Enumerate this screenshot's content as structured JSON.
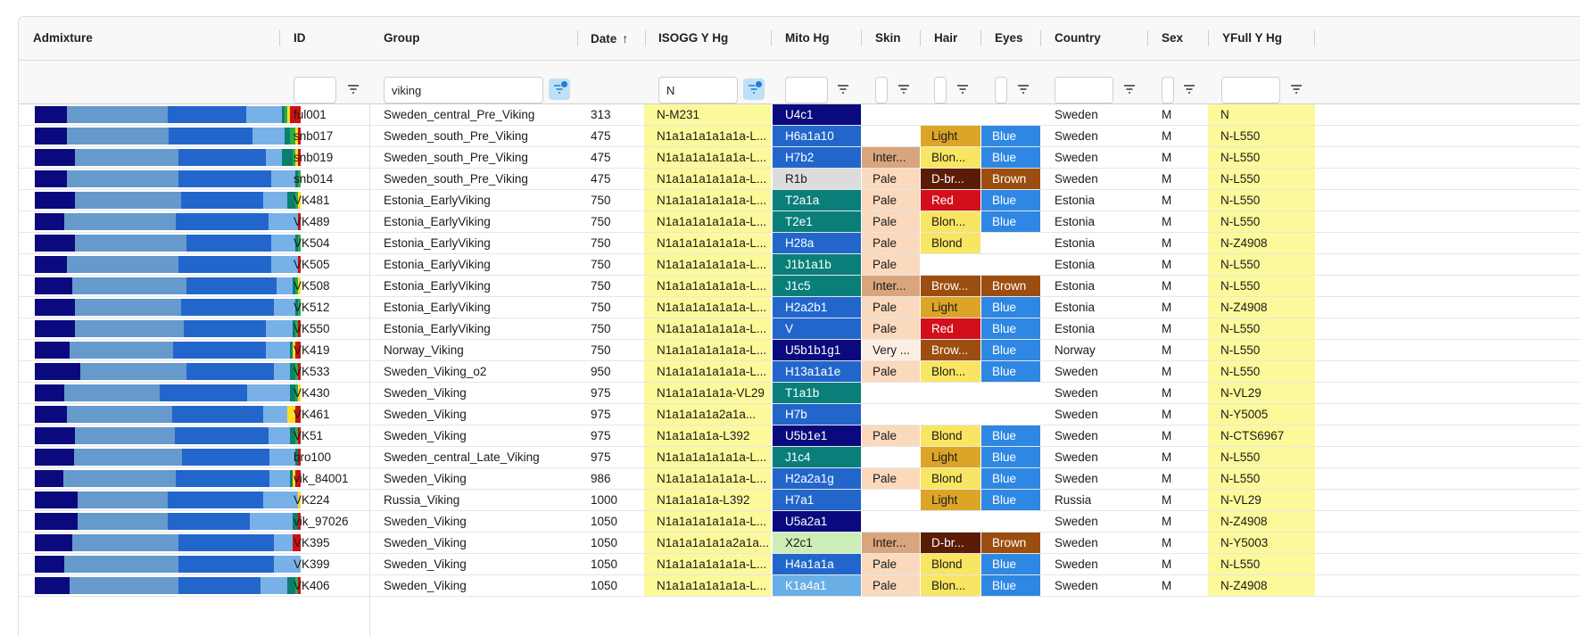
{
  "columns": {
    "admixture": "Admixture",
    "id": "ID",
    "group": "Group",
    "date": "Date",
    "isogg": "ISOGG Y Hg",
    "mito": "Mito Hg",
    "skin": "Skin",
    "hair": "Hair",
    "eyes": "Eyes",
    "country": "Country",
    "sex": "Sex",
    "yfull": "YFull Y Hg"
  },
  "sort": {
    "column": "date",
    "direction": "ascending",
    "icon": "arrow-up-icon"
  },
  "filters": {
    "id": "",
    "group": "viking",
    "isogg": "N",
    "mito": "",
    "skin": "",
    "hair": "",
    "eyes": "",
    "country": "",
    "sex": "",
    "yfull": ""
  },
  "active_filters": [
    "group",
    "isogg"
  ],
  "colors": {
    "isogg_bg": "#fcf99a",
    "yfull_bg": "#fcf99a",
    "filter_active_bg": "#bfe0f7",
    "filter_active_dot": "#1f7fd6",
    "mito": {
      "U": "#0a0a7e",
      "H": "#2266cc",
      "R": "#dcdcdc",
      "T": "#0a7f7a",
      "J": "#0a7f7a",
      "V": "#2266cc",
      "X": "#cdeeb7",
      "K": "#6aaee6"
    },
    "skin": {
      "Pale": "#fbd9bd",
      "Inter...": "#d9a57d",
      "Very ...": "#fdeee4"
    },
    "hair": {
      "Light": "#dca527",
      "Blon...": "#f8e662",
      "Blond": "#f8e662",
      "D-br...": "#5a1c04",
      "Red": "#d40f1c",
      "Brow...": "#9c4d10"
    },
    "eyes": {
      "Blue": "#2e87e2",
      "Brown": "#9c4d10"
    }
  },
  "rows": [
    {
      "id": "ful001",
      "group": "Sweden_central_Pre_Viking",
      "date": "313",
      "isogg": "N-M231",
      "mito": "U4c1",
      "skin": "",
      "hair": "",
      "eyes": "",
      "country": "Sweden",
      "sex": "M",
      "yfull": "N",
      "admixture": [
        12,
        37,
        29,
        13,
        1,
        1,
        1,
        4
      ]
    },
    {
      "id": "snb017",
      "group": "Sweden_south_Pre_Viking",
      "date": "475",
      "isogg": "N1a1a1a1a1a1a-L...",
      "mito": "H6a1a10",
      "skin": "",
      "hair": "Light",
      "eyes": "Blue",
      "country": "Sweden",
      "sex": "M",
      "yfull": "N-L550",
      "admixture": [
        12,
        38,
        31,
        12,
        2,
        2,
        1,
        1
      ]
    },
    {
      "id": "snb019",
      "group": "Sweden_south_Pre_Viking",
      "date": "475",
      "isogg": "N1a1a1a1a1a1a-L...",
      "mito": "H7b2",
      "skin": "Inter...",
      "hair": "Blon...",
      "eyes": "Blue",
      "country": "Sweden",
      "sex": "M",
      "yfull": "N-L550",
      "admixture": [
        15,
        39,
        33,
        6,
        4,
        1,
        1,
        1
      ]
    },
    {
      "id": "snb014",
      "group": "Sweden_south_Pre_Viking",
      "date": "475",
      "isogg": "N1a1a1a1a1a1a-L...",
      "mito": "R1b",
      "skin": "Pale",
      "hair": "D-br...",
      "eyes": "Brown",
      "country": "Sweden",
      "sex": "M",
      "yfull": "N-L550",
      "admixture": [
        12,
        42,
        35,
        9,
        1,
        1,
        0,
        0
      ]
    },
    {
      "id": "VK481",
      "group": "Estonia_EarlyViking",
      "date": "750",
      "isogg": "N1a1a1a1a1a1a-L...",
      "mito": "T2a1a",
      "skin": "Pale",
      "hair": "Red",
      "eyes": "Blue",
      "country": "Estonia",
      "sex": "M",
      "yfull": "N-L550",
      "admixture": [
        15,
        40,
        31,
        9,
        3,
        1,
        1,
        0
      ]
    },
    {
      "id": "VK489",
      "group": "Estonia_EarlyViking",
      "date": "750",
      "isogg": "N1a1a1a1a1a1a-L...",
      "mito": "T2e1",
      "skin": "Pale",
      "hair": "Blon...",
      "eyes": "Blue",
      "country": "Estonia",
      "sex": "M",
      "yfull": "N-L550",
      "admixture": [
        11,
        42,
        35,
        11,
        0,
        0,
        0,
        1
      ]
    },
    {
      "id": "VK504",
      "group": "Estonia_EarlyViking",
      "date": "750",
      "isogg": "N1a1a1a1a1a1a-L...",
      "mito": "H28a",
      "skin": "Pale",
      "hair": "Blond",
      "eyes": "",
      "country": "Estonia",
      "sex": "M",
      "yfull": "N-Z4908",
      "admixture": [
        15,
        42,
        32,
        9,
        1,
        1,
        0,
        0
      ]
    },
    {
      "id": "VK505",
      "group": "Estonia_EarlyViking",
      "date": "750",
      "isogg": "N1a1a1a1a1a1a-L...",
      "mito": "J1b1a1b",
      "skin": "Pale",
      "hair": "",
      "eyes": "",
      "country": "Estonia",
      "sex": "M",
      "yfull": "N-L550",
      "admixture": [
        12,
        42,
        35,
        10,
        0,
        0,
        0,
        1
      ]
    },
    {
      "id": "VK508",
      "group": "Estonia_EarlyViking",
      "date": "750",
      "isogg": "N1a1a1a1a1a1a-L...",
      "mito": "J1c5",
      "skin": "Inter...",
      "hair": "Brow...",
      "eyes": "Brown",
      "country": "Estonia",
      "sex": "M",
      "yfull": "N-L550",
      "admixture": [
        14,
        43,
        34,
        6,
        1,
        1,
        1,
        0
      ]
    },
    {
      "id": "VK512",
      "group": "Estonia_EarlyViking",
      "date": "750",
      "isogg": "N1a1a1a1a1a1a-L...",
      "mito": "H2a2b1",
      "skin": "Pale",
      "hair": "Light",
      "eyes": "Blue",
      "country": "Estonia",
      "sex": "M",
      "yfull": "N-Z4908",
      "admixture": [
        15,
        40,
        35,
        8,
        1,
        1,
        0,
        0
      ]
    },
    {
      "id": "VK550",
      "group": "Estonia_EarlyViking",
      "date": "750",
      "isogg": "N1a1a1a1a1a1a-L...",
      "mito": "V",
      "skin": "Pale",
      "hair": "Red",
      "eyes": "Blue",
      "country": "Estonia",
      "sex": "M",
      "yfull": "N-L550",
      "admixture": [
        15,
        41,
        31,
        10,
        1,
        1,
        0,
        1
      ]
    },
    {
      "id": "VK419",
      "group": "Norway_Viking",
      "date": "750",
      "isogg": "N1a1a1a1a1a1a-L...",
      "mito": "U5b1b1g1",
      "skin": "Very ...",
      "hair": "Brow...",
      "eyes": "Blue",
      "country": "Norway",
      "sex": "M",
      "yfull": "N-L550",
      "admixture": [
        13,
        39,
        35,
        9,
        1,
        0,
        1,
        2
      ]
    },
    {
      "id": "VK533",
      "group": "Sweden_Viking_o2",
      "date": "950",
      "isogg": "N1a1a1a1a1a1a-L...",
      "mito": "H13a1a1e",
      "skin": "Pale",
      "hair": "Blon...",
      "eyes": "Blue",
      "country": "Sweden",
      "sex": "M",
      "yfull": "N-L550",
      "admixture": [
        17,
        40,
        33,
        6,
        2,
        1,
        0,
        1
      ]
    },
    {
      "id": "VK430",
      "group": "Sweden_Viking",
      "date": "975",
      "isogg": "N1a1a1a1a1a-VL29",
      "mito": "T1a1b",
      "skin": "",
      "hair": "",
      "eyes": "",
      "country": "Sweden",
      "sex": "M",
      "yfull": "N-VL29",
      "admixture": [
        11,
        36,
        33,
        16,
        2,
        1,
        1,
        0
      ]
    },
    {
      "id": "VK461",
      "group": "Sweden_Viking",
      "date": "975",
      "isogg": "N1a1a1a1a2a1a...",
      "mito": "H7b",
      "skin": "",
      "hair": "",
      "eyes": "",
      "country": "Sweden",
      "sex": "M",
      "yfull": "N-Y5005",
      "admixture": [
        12,
        39,
        34,
        9,
        0,
        0,
        3,
        2
      ]
    },
    {
      "id": "VK51",
      "group": "Sweden_Viking",
      "date": "975",
      "isogg": "N1a1a1a1a-L392",
      "mito": "U5b1e1",
      "skin": "Pale",
      "hair": "Blond",
      "eyes": "Blue",
      "country": "Sweden",
      "sex": "M",
      "yfull": "N-CTS6967",
      "admixture": [
        15,
        37,
        35,
        8,
        2,
        1,
        0,
        1
      ]
    },
    {
      "id": "bro100",
      "group": "Sweden_central_Late_Viking",
      "date": "975",
      "isogg": "N1a1a1a1a1a1a-L...",
      "mito": "J1c4",
      "skin": "",
      "hair": "Light",
      "eyes": "Blue",
      "country": "Sweden",
      "sex": "M",
      "yfull": "N-L550",
      "admixture": [
        15,
        41,
        33,
        10,
        1,
        0,
        0,
        1
      ]
    },
    {
      "id": "vik_84001",
      "group": "Sweden_Viking",
      "date": "986",
      "isogg": "N1a1a1a1a1a1a-L...",
      "mito": "H2a2a1g",
      "skin": "Pale",
      "hair": "Blond",
      "eyes": "Blue",
      "country": "Sweden",
      "sex": "M",
      "yfull": "N-L550",
      "admixture": [
        11,
        43,
        36,
        8,
        1,
        0,
        1,
        2
      ]
    },
    {
      "id": "VK224",
      "group": "Russia_Viking",
      "date": "1000",
      "isogg": "N1a1a1a1a-L392",
      "mito": "H7a1",
      "skin": "",
      "hair": "Light",
      "eyes": "Blue",
      "country": "Russia",
      "sex": "M",
      "yfull": "N-VL29",
      "admixture": [
        16,
        34,
        36,
        13,
        0,
        0,
        1,
        0
      ]
    },
    {
      "id": "vik_97026",
      "group": "Sweden_Viking",
      "date": "1050",
      "isogg": "N1a1a1a1a1a1a-L...",
      "mito": "U5a2a1",
      "skin": "",
      "hair": "",
      "eyes": "",
      "country": "Sweden",
      "sex": "M",
      "yfull": "N-Z4908",
      "admixture": [
        16,
        34,
        31,
        16,
        2,
        0,
        0,
        1
      ]
    },
    {
      "id": "VK395",
      "group": "Sweden_Viking",
      "date": "1050",
      "isogg": "N1a1a1a1a1a2a1a...",
      "mito": "X2c1",
      "skin": "Inter...",
      "hair": "D-br...",
      "eyes": "Brown",
      "country": "Sweden",
      "sex": "M",
      "yfull": "N-Y5003",
      "admixture": [
        14,
        40,
        36,
        7,
        0,
        0,
        0,
        3
      ]
    },
    {
      "id": "VK399",
      "group": "Sweden_Viking",
      "date": "1050",
      "isogg": "N1a1a1a1a1a1a-L...",
      "mito": "H4a1a1a",
      "skin": "Pale",
      "hair": "Blond",
      "eyes": "Blue",
      "country": "Sweden",
      "sex": "M",
      "yfull": "N-L550",
      "admixture": [
        11,
        43,
        36,
        10,
        0,
        0,
        0,
        0
      ]
    },
    {
      "id": "VK406",
      "group": "Sweden_Viking",
      "date": "1050",
      "isogg": "N1a1a1a1a1a1a-L...",
      "mito": "K1a4a1",
      "skin": "Pale",
      "hair": "Blon...",
      "eyes": "Blue",
      "country": "Sweden",
      "sex": "M",
      "yfull": "N-Z4908",
      "admixture": [
        13,
        41,
        31,
        10,
        3,
        1,
        0,
        1
      ]
    }
  ],
  "admixture_palette": [
    "#0a0a7e",
    "#6699cc",
    "#2266cc",
    "#77b1e8",
    "#0a7f6e",
    "#2eaa46",
    "#ffdd22",
    "#cc1111"
  ]
}
